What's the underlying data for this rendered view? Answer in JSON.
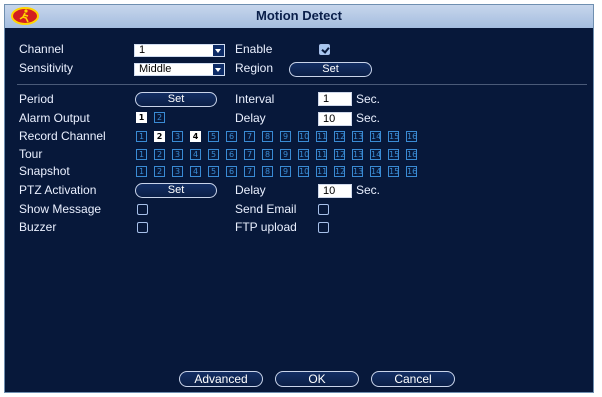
{
  "window": {
    "title": "Motion Detect"
  },
  "row1": {
    "channel_label": "Channel",
    "channel_value": "1",
    "enable_label": "Enable",
    "enable_checked": true
  },
  "row2": {
    "sensitivity_label": "Sensitivity",
    "sensitivity_value": "Middle",
    "region_label": "Region",
    "region_button": "Set"
  },
  "period": {
    "label": "Period",
    "button": "Set"
  },
  "interval": {
    "label": "Interval",
    "value": "1",
    "unit": "Sec."
  },
  "alarm_output": {
    "label": "Alarm Output",
    "channels": [
      "1",
      "2"
    ],
    "selected": [
      "1"
    ]
  },
  "delay1": {
    "label": "Delay",
    "value": "10",
    "unit": "Sec."
  },
  "record_channel": {
    "label": "Record Channel",
    "channels": [
      "1",
      "2",
      "3",
      "4",
      "5",
      "6",
      "7",
      "8",
      "9",
      "10",
      "11",
      "12",
      "13",
      "14",
      "15",
      "16"
    ],
    "selected": [
      "2",
      "4"
    ]
  },
  "tour": {
    "label": "Tour",
    "channels": [
      "1",
      "2",
      "3",
      "4",
      "5",
      "6",
      "7",
      "8",
      "9",
      "10",
      "11",
      "12",
      "13",
      "14",
      "15",
      "16"
    ],
    "selected": []
  },
  "snapshot": {
    "label": "Snapshot",
    "channels": [
      "1",
      "2",
      "3",
      "4",
      "5",
      "6",
      "7",
      "8",
      "9",
      "10",
      "11",
      "12",
      "13",
      "14",
      "15",
      "16"
    ],
    "selected": []
  },
  "ptz": {
    "label": "PTZ Activation",
    "button": "Set"
  },
  "delay2": {
    "label": "Delay",
    "value": "10",
    "unit": "Sec."
  },
  "show_message": {
    "label": "Show Message",
    "checked": false
  },
  "send_email": {
    "label": "Send Email",
    "checked": false
  },
  "buzzer": {
    "label": "Buzzer",
    "checked": false
  },
  "ftp_upload": {
    "label": "FTP upload",
    "checked": false
  },
  "footer": {
    "advanced": "Advanced",
    "ok": "OK",
    "cancel": "Cancel"
  },
  "icons": {
    "logo": "motion-person-icon",
    "dropdown": "chevron-down-icon"
  },
  "colors": {
    "title_bar": "#b4c8e6",
    "background": "#07183a",
    "channel_blue": "#3a8bd4"
  }
}
